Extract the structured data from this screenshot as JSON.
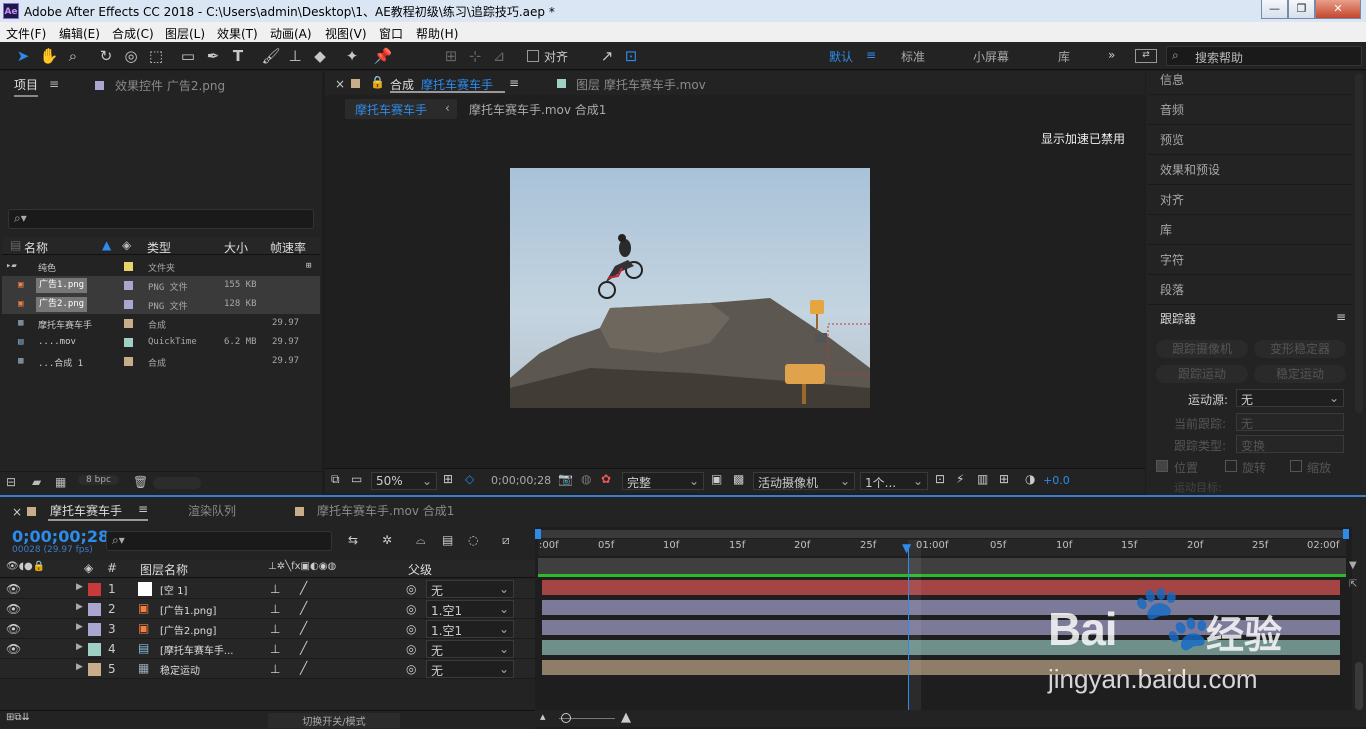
{
  "window": {
    "title": "Adobe After Effects CC 2018 - C:\\Users\\admin\\Desktop\\1、AE教程初级\\练习\\追踪技巧.aep *",
    "app_icon": "Ae",
    "min": "—",
    "max": "❐",
    "close": "✕"
  },
  "menu": [
    "文件(F)",
    "编辑(E)",
    "合成(C)",
    "图层(L)",
    "效果(T)",
    "动画(A)",
    "视图(V)",
    "窗口",
    "帮助(H)"
  ],
  "toolbar": {
    "align_label": "对齐",
    "workspaces": [
      "默认",
      "标准",
      "小屏幕",
      "库"
    ],
    "more": "»",
    "search_placeholder": "搜索帮助",
    "accent": "#2d8ceb"
  },
  "project": {
    "tab": "项目",
    "effects_tab": "效果控件 广告2.png",
    "search_placeholder": "",
    "columns": [
      "名称",
      "类型",
      "大小",
      "帧速率"
    ],
    "items": [
      {
        "name": "纯色",
        "type": "文件夹",
        "size": "",
        "fps": "",
        "color": "#e8d36a",
        "icon": "folder-icon"
      },
      {
        "name": "广告1.png",
        "type": "PNG 文件",
        "size": "155 KB",
        "fps": "",
        "color": "#a9a6cf",
        "icon": "png-icon"
      },
      {
        "name": "广告2.png",
        "type": "PNG 文件",
        "size": "128 KB",
        "fps": "",
        "color": "#a9a6cf",
        "icon": "png-icon"
      },
      {
        "name": "摩托车赛车手",
        "type": "合成",
        "size": "",
        "fps": "29.97",
        "color": "#c7ad8a",
        "icon": "comp-icon"
      },
      {
        "name": "....mov",
        "type": "QuickTime",
        "size": "6.2 MB",
        "fps": "29.97",
        "color": "#9fd0c6",
        "icon": "movie-icon"
      },
      {
        "name": "...合成 1",
        "type": "合成",
        "size": "",
        "fps": "29.97",
        "color": "#c7ad8a",
        "icon": "comp-icon"
      }
    ],
    "bpc": "8 bpc"
  },
  "composition": {
    "tab_prefix": "合成",
    "tab_name": "摩托车赛车手",
    "layer_tab": "图层 摩托车赛车手.mov",
    "breadcrumb_active": "摩托车赛车手",
    "breadcrumb_next": "摩托车赛车手.mov 合成1",
    "accel_notice": "显示加速已禁用",
    "controls": {
      "zoom": "50%",
      "timecode": "0;00;00;28",
      "quality": "完整",
      "camera": "活动摄像机",
      "views": "1个...",
      "exposure": "+0.0"
    }
  },
  "right_panel": {
    "items": [
      "信息",
      "音频",
      "预览",
      "效果和预设",
      "对齐",
      "库",
      "字符",
      "段落"
    ],
    "tracker": {
      "title": "跟踪器",
      "track_camera": "跟踪摄像机",
      "warp_stabilizer": "变形稳定器",
      "track_motion": "跟踪运动",
      "stabilize_motion": "稳定运动",
      "motion_source_label": "运动源:",
      "motion_source_value": "无",
      "current_track_label": "当前跟踪:",
      "current_track_value": "无",
      "track_type_label": "跟踪类型:",
      "track_type_value": "变换",
      "position": "位置",
      "rotation": "旋转",
      "scale": "缩放",
      "motion_target": "运动目标:"
    }
  },
  "timeline": {
    "tab": "摩托车赛车手",
    "render_tab": "渲染队列",
    "other_tab": "摩托车赛车手.mov 合成1",
    "timecode": "0;00;00;28",
    "frame_info": "00028 (29.97 fps)",
    "search_placeholder": "",
    "header_name": "图层名称",
    "header_parent": "父级",
    "header_hash": "#",
    "ticks": [
      ":00f",
      "05f",
      "10f",
      "15f",
      "20f",
      "25f",
      "01:00f",
      "05f",
      "10f",
      "15f",
      "20f",
      "25f",
      "02:00f"
    ],
    "layers": [
      {
        "num": "1",
        "name": "[空 1]",
        "parent": "无",
        "label": "#c83a3a",
        "bar": "#a44444",
        "icon": "null-icon"
      },
      {
        "num": "2",
        "name": "[广告1.png]",
        "parent": "1.空1",
        "label": "#a9a6cf",
        "bar": "#7c7a99",
        "icon": "png-icon"
      },
      {
        "num": "3",
        "name": "[广告2.png]",
        "parent": "1.空1",
        "label": "#a9a6cf",
        "bar": "#7c7a99",
        "icon": "png-icon"
      },
      {
        "num": "4",
        "name": "[摩托车赛车手...",
        "parent": "无",
        "label": "#9fd0c6",
        "bar": "#6f8f8b",
        "icon": "movie-icon"
      },
      {
        "num": "5",
        "name": "稳定运动",
        "parent": "无",
        "label": "#c7ad8a",
        "bar": "#8e7d68",
        "icon": "comp-icon"
      }
    ],
    "toggle_label": "切换开关/模式"
  },
  "watermark": {
    "brand": "Bai",
    "brand2": "经验",
    "url": "jingyan.baidu.com"
  }
}
